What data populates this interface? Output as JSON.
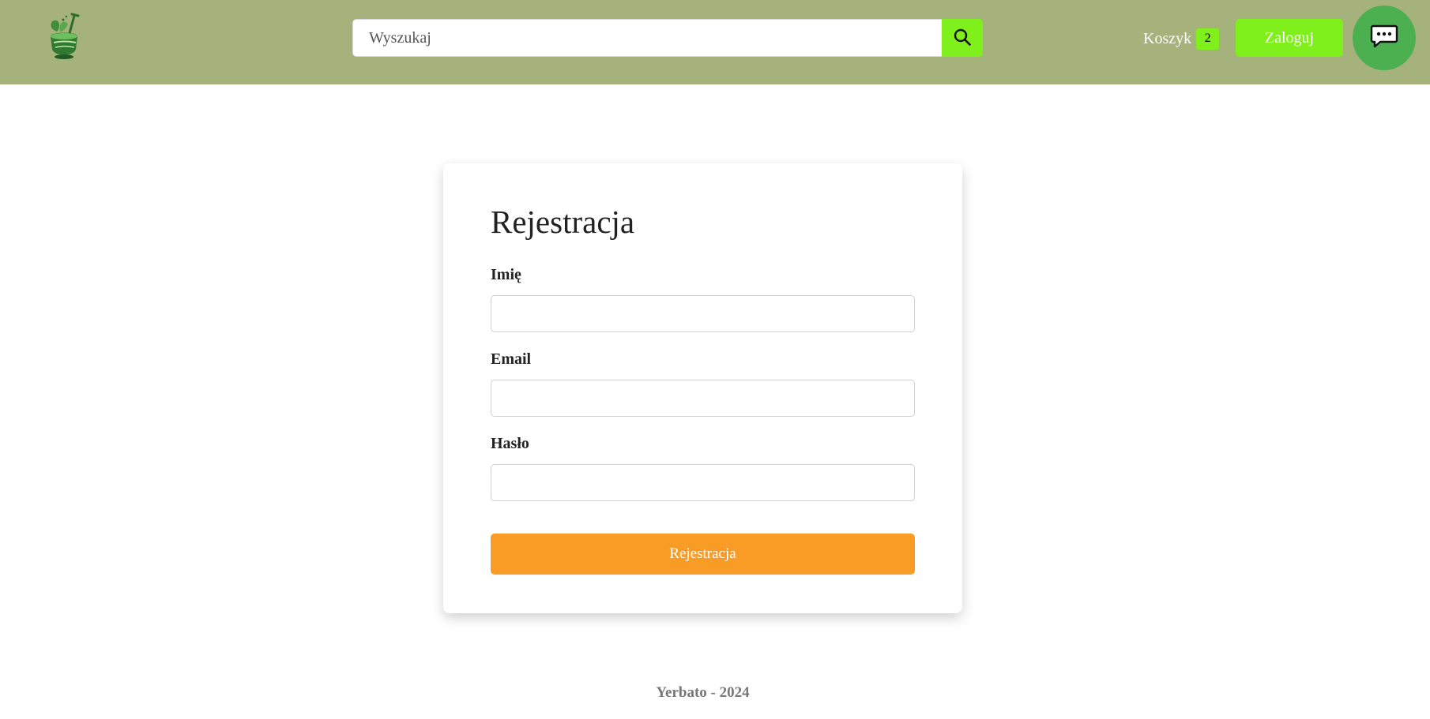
{
  "header": {
    "logo_icon": "mate-cup-leaf-icon",
    "search": {
      "placeholder": "Wyszukaj",
      "value": "",
      "icon": "search-icon"
    },
    "cart": {
      "label": "Koszyk",
      "count": "2"
    },
    "login_label": "Zaloguj",
    "chat_icon": "chat-bubble-icon"
  },
  "form": {
    "title": "Rejestracja",
    "fields": [
      {
        "label": "Imię",
        "value": ""
      },
      {
        "label": "Email",
        "value": ""
      },
      {
        "label": "Hasło",
        "value": ""
      }
    ],
    "submit_label": "Rejestracja"
  },
  "footer": {
    "text": "Yerbato - 2024"
  },
  "colors": {
    "header_bg": "#a5b27b",
    "accent_green": "#7ff01c",
    "chat_green": "#4caf50",
    "submit_orange": "#f99c26"
  }
}
